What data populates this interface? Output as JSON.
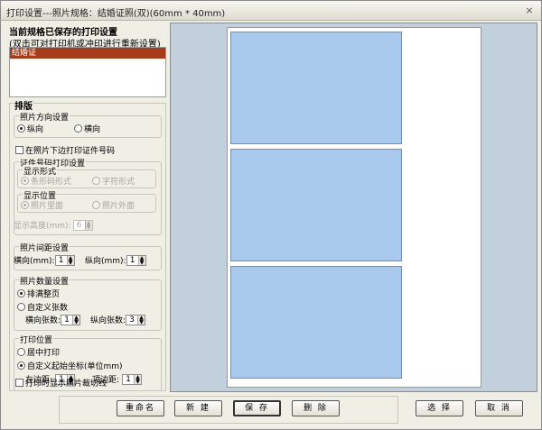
{
  "window": {
    "title": "打印设置---照片规格：结婚证照(双)(60mm * 40mm)",
    "close_glyph": "×"
  },
  "saved": {
    "title": "当前规格已保存的打印设置",
    "hint": "(双击可对打印机或冲印进行重新设置)",
    "items": [
      "结婚证"
    ]
  },
  "layout": {
    "label": "排版",
    "orientation": {
      "label": "照片方向设置",
      "portrait": "纵向",
      "landscape": "横向",
      "selected": "portrait"
    },
    "print_id_checkbox": "在照片下边打印证件号码",
    "id_print": {
      "label": "证件号码打印设置",
      "format": {
        "label": "显示形式",
        "barcode": "条形码形式",
        "text": "字符形式"
      },
      "position": {
        "label": "显示位置",
        "inside": "照片里面",
        "outside": "照片外面"
      },
      "height_label": "显示高度(mm):",
      "height_value": "6"
    },
    "spacing": {
      "label": "照片间距设置",
      "horizontal_label": "横向(mm):",
      "horizontal_value": "1",
      "vertical_label": "纵向(mm):",
      "vertical_value": "1"
    },
    "count": {
      "label": "照片数量设置",
      "fill_page": "排满整页",
      "custom": "自定义张数",
      "selected": "fill_page",
      "horizontal_label": "横向张数:",
      "horizontal_value": "1",
      "vertical_label": "纵向张数:",
      "vertical_value": "3"
    },
    "print_position": {
      "label": "打印位置",
      "center": "居中打印",
      "custom": "自定义起始坐标(单位mm)",
      "selected": "custom",
      "left_label": "左边距:",
      "left_value": "1",
      "top_label": "顶边距:",
      "top_value": "1"
    },
    "cut_lines_checkbox": "打印时显示照片裁切线"
  },
  "preview": {
    "photos": 3
  },
  "buttons": {
    "rename": "重命名",
    "new": "新 建",
    "save": "保 存",
    "delete": "删 除",
    "select": "选 择",
    "cancel": "取 消"
  },
  "colors": {
    "photo": "#a8c8ec",
    "preview_bg": "#c2cfdc",
    "selected_item": "#a63b1a"
  }
}
